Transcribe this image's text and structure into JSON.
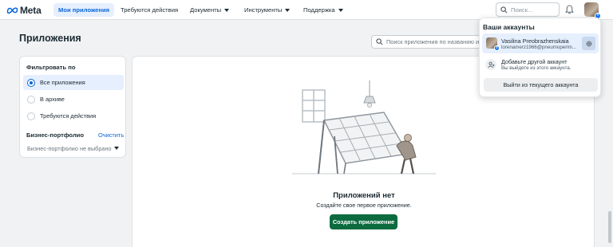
{
  "brand": {
    "logo_text": "Meta",
    "accent": "#0a66d8",
    "cta_color": "#0b6b3f"
  },
  "nav": {
    "items": [
      {
        "label": "Мои приложения",
        "active": true,
        "caret": false
      },
      {
        "label": "Требуются действия",
        "active": false,
        "caret": false
      },
      {
        "label": "Документы",
        "active": false,
        "caret": true
      },
      {
        "label": "Инструменты",
        "active": false,
        "caret": true
      },
      {
        "label": "Поддержка",
        "active": false,
        "caret": true
      }
    ],
    "search_placeholder": "Поиск..."
  },
  "page": {
    "title": "Приложения",
    "search_placeholder": "Поиск приложения по названию или"
  },
  "filters": {
    "title": "Фильтровать по",
    "options": [
      {
        "label": "Все приложения",
        "selected": true
      },
      {
        "label": "В архиве",
        "selected": false
      },
      {
        "label": "Требуются действия",
        "selected": false
      }
    ],
    "business_portfolio_label": "Бизнес-портфолио",
    "clear_label": "Очистить",
    "business_portfolio_value": "Бизнес-портфолио не выбрано"
  },
  "empty_state": {
    "title": "Приложений нет",
    "subtitle": "Создайте свое первое приложение.",
    "button_label": "Создать приложение",
    "illustration_icon": "greenhouse-illustration-icon"
  },
  "accounts_menu": {
    "title": "Ваши аккаунты",
    "current_account": {
      "name": "Vasilina Preobrazhenskaia",
      "email": "lorenamerz1966@pneumoperim..."
    },
    "add_account_label": "Добавьте другой аккаунт",
    "add_account_sub": "Вы выйдете из этого аккаунта.",
    "logout_label": "Выйти из текущего аккаунта"
  }
}
